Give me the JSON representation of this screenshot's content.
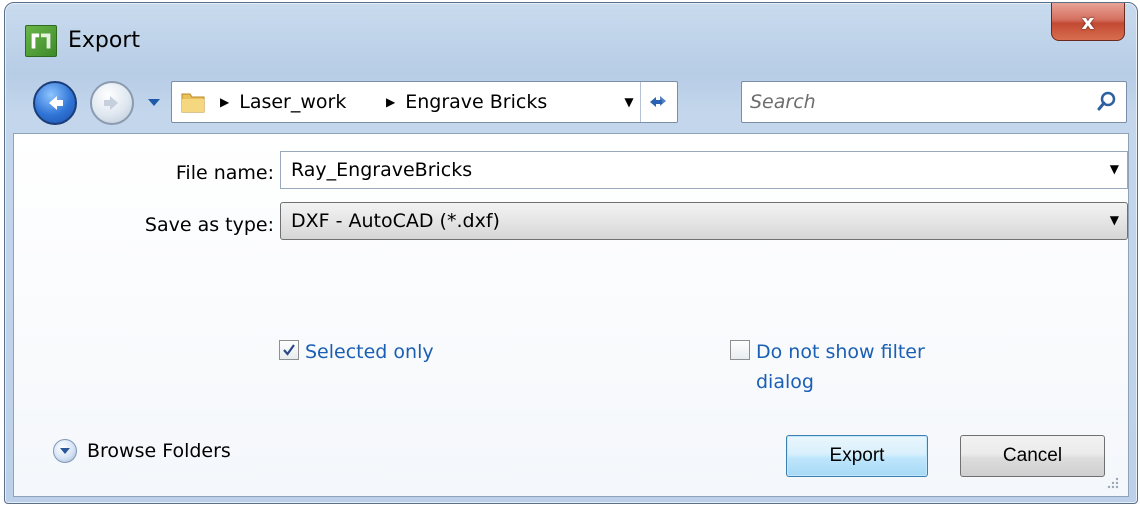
{
  "window": {
    "title": "Export",
    "close_label": "x"
  },
  "nav": {
    "breadcrumbs": [
      "Laser_work",
      "Engrave Bricks"
    ]
  },
  "search": {
    "placeholder": "Search"
  },
  "form": {
    "file_name_label": "File name:",
    "file_name_value": "Ray_EngraveBricks",
    "save_type_label": "Save as type:",
    "save_type_value": "DXF - AutoCAD (*.dxf)"
  },
  "options": {
    "selected_only": {
      "label": "Selected only",
      "checked": true
    },
    "no_filter_dialog": {
      "label_line1": "Do not show filter",
      "label_line2": "dialog",
      "checked": false
    }
  },
  "footer": {
    "browse_label": "Browse Folders",
    "export_label": "Export",
    "cancel_label": "Cancel"
  }
}
